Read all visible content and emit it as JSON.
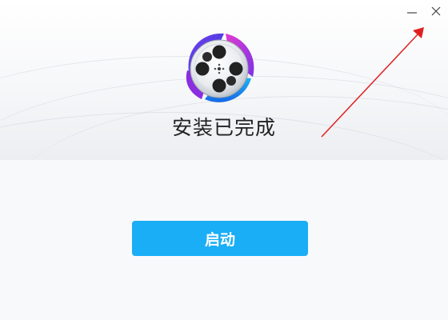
{
  "window": {
    "title_icons": [
      "minimize-icon",
      "close-icon"
    ]
  },
  "main": {
    "status_title": "安装已完成",
    "launch_button_label": "启动"
  },
  "colors": {
    "accent": "#19aef5",
    "annotation_arrow": "#e02020",
    "logo_ring_left": "#3d3fd9",
    "logo_ring_right": "#d12ecb"
  },
  "icons": {
    "app_logo": "film-reel-icon",
    "annotation": "red-arrow-icon"
  }
}
